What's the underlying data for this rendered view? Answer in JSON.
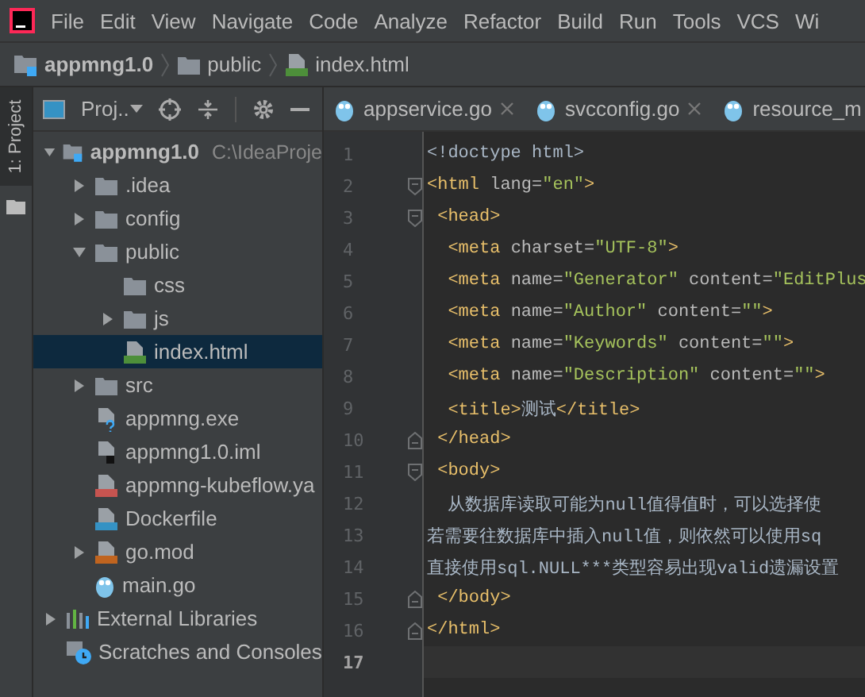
{
  "menu": [
    "File",
    "Edit",
    "View",
    "Navigate",
    "Code",
    "Analyze",
    "Refactor",
    "Build",
    "Run",
    "Tools",
    "VCS",
    "Wi"
  ],
  "breadcrumb": [
    {
      "label": "appmng1.0",
      "kind": "project"
    },
    {
      "label": "public",
      "kind": "folder"
    },
    {
      "label": "index.html",
      "kind": "html"
    }
  ],
  "side_strip": {
    "label": "1: Project",
    "selected": true
  },
  "project_panel": {
    "title": "Proj..",
    "tree": [
      {
        "name": "appmng1.0",
        "path": "C:\\IdeaProje",
        "kind": "project",
        "expanded": true,
        "selected": false,
        "children": [
          {
            "name": ".idea",
            "kind": "folder",
            "expanded": false,
            "selected": false
          },
          {
            "name": "config",
            "kind": "folder",
            "expanded": false,
            "selected": false
          },
          {
            "name": "public",
            "kind": "folder",
            "expanded": true,
            "selected": false,
            "children": [
              {
                "name": "css",
                "kind": "folder",
                "selected": false
              },
              {
                "name": "js",
                "kind": "folder",
                "expanded": false,
                "selected": false
              },
              {
                "name": "index.html",
                "kind": "html",
                "selected": true
              }
            ]
          },
          {
            "name": "src",
            "kind": "folder",
            "expanded": false,
            "selected": false
          },
          {
            "name": "appmng.exe",
            "kind": "unknown",
            "selected": false
          },
          {
            "name": "appmng1.0.iml",
            "kind": "iml",
            "selected": false
          },
          {
            "name": "appmng-kubeflow.ya",
            "kind": "yaml",
            "selected": false
          },
          {
            "name": "Dockerfile",
            "kind": "docker",
            "selected": false
          },
          {
            "name": "go.mod",
            "kind": "dtd",
            "expanded": false,
            "selected": false
          },
          {
            "name": "main.go",
            "kind": "go",
            "selected": false
          }
        ]
      },
      {
        "name": "External Libraries",
        "kind": "libraries",
        "expanded": false,
        "selected": false
      },
      {
        "name": "Scratches and Consoles",
        "kind": "scratches",
        "selected": false
      }
    ]
  },
  "editor_tabs": [
    {
      "label": "appservice.go",
      "selected": false
    },
    {
      "label": "svcconfig.go",
      "selected": false
    },
    {
      "label": "resource_m",
      "selected": false
    }
  ],
  "editor": {
    "lines": [
      {
        "n": "1",
        "kind": "plain",
        "current": false,
        "tokens": [
          {
            "kind": "text",
            "t": "<!doctype html>"
          }
        ]
      },
      {
        "n": "2",
        "kind": "fold-start",
        "current": false,
        "tokens": [
          {
            "kind": "tag",
            "t": "<html "
          },
          {
            "kind": "attr",
            "t": "lang="
          },
          {
            "kind": "value",
            "t": "\"en\""
          },
          {
            "kind": "tag",
            "t": ">"
          }
        ]
      },
      {
        "n": "3",
        "kind": "fold-start",
        "current": false,
        "tokens": [
          {
            "kind": "tag",
            "t": " <head>"
          }
        ]
      },
      {
        "n": "4",
        "kind": "plain",
        "current": false,
        "tokens": [
          {
            "kind": "tag",
            "t": "  <meta "
          },
          {
            "kind": "attr",
            "t": "charset="
          },
          {
            "kind": "value",
            "t": "\"UTF-8\""
          },
          {
            "kind": "tag",
            "t": ">"
          }
        ]
      },
      {
        "n": "5",
        "kind": "plain",
        "current": false,
        "tokens": [
          {
            "kind": "tag",
            "t": "  <meta "
          },
          {
            "kind": "attr",
            "t": "name="
          },
          {
            "kind": "value",
            "t": "\"Generator\""
          },
          {
            "kind": "attr",
            "t": " content="
          },
          {
            "kind": "value",
            "t": "\"EditPlus"
          }
        ]
      },
      {
        "n": "6",
        "kind": "plain",
        "current": false,
        "tokens": [
          {
            "kind": "tag",
            "t": "  <meta "
          },
          {
            "kind": "attr",
            "t": "name="
          },
          {
            "kind": "value",
            "t": "\"Author\""
          },
          {
            "kind": "attr",
            "t": " content="
          },
          {
            "kind": "value",
            "t": "\"\""
          },
          {
            "kind": "tag",
            "t": ">"
          }
        ]
      },
      {
        "n": "7",
        "kind": "plain",
        "current": false,
        "tokens": [
          {
            "kind": "tag",
            "t": "  <meta "
          },
          {
            "kind": "attr",
            "t": "name="
          },
          {
            "kind": "value",
            "t": "\"Keywords\""
          },
          {
            "kind": "attr",
            "t": " content="
          },
          {
            "kind": "value",
            "t": "\"\""
          },
          {
            "kind": "tag",
            "t": ">"
          }
        ]
      },
      {
        "n": "8",
        "kind": "plain",
        "current": false,
        "tokens": [
          {
            "kind": "tag",
            "t": "  <meta "
          },
          {
            "kind": "attr",
            "t": "name="
          },
          {
            "kind": "value",
            "t": "\"Description\""
          },
          {
            "kind": "attr",
            "t": " content="
          },
          {
            "kind": "value",
            "t": "\"\""
          },
          {
            "kind": "tag",
            "t": ">"
          }
        ]
      },
      {
        "n": "9",
        "kind": "plain",
        "current": false,
        "tokens": [
          {
            "kind": "tag",
            "t": "  <title>"
          },
          {
            "kind": "text",
            "t": "测试"
          },
          {
            "kind": "tag",
            "t": "</title>"
          }
        ]
      },
      {
        "n": "10",
        "kind": "fold-end",
        "current": false,
        "tokens": [
          {
            "kind": "tag",
            "t": " </head>"
          }
        ]
      },
      {
        "n": "11",
        "kind": "fold-start",
        "current": false,
        "tokens": [
          {
            "kind": "tag",
            "t": " <body>"
          }
        ]
      },
      {
        "n": "12",
        "kind": "plain",
        "current": false,
        "tokens": [
          {
            "kind": "text",
            "t": "  从数据库读取可能为null值得值时，可以选择使"
          }
        ]
      },
      {
        "n": "13",
        "kind": "plain",
        "current": false,
        "tokens": [
          {
            "kind": "text",
            "t": "若需要往数据库中插入null值，则依然可以使用sq"
          }
        ]
      },
      {
        "n": "14",
        "kind": "plain",
        "current": false,
        "tokens": [
          {
            "kind": "text",
            "t": "直接使用sql.NULL***类型容易出现valid遗漏设置"
          }
        ]
      },
      {
        "n": "15",
        "kind": "fold-end",
        "current": false,
        "tokens": [
          {
            "kind": "tag",
            "t": " </body>"
          }
        ]
      },
      {
        "n": "16",
        "kind": "fold-end",
        "current": false,
        "tokens": [
          {
            "kind": "tag",
            "t": "</html>"
          }
        ]
      },
      {
        "n": "17",
        "kind": "plain",
        "current": true
      }
    ]
  }
}
